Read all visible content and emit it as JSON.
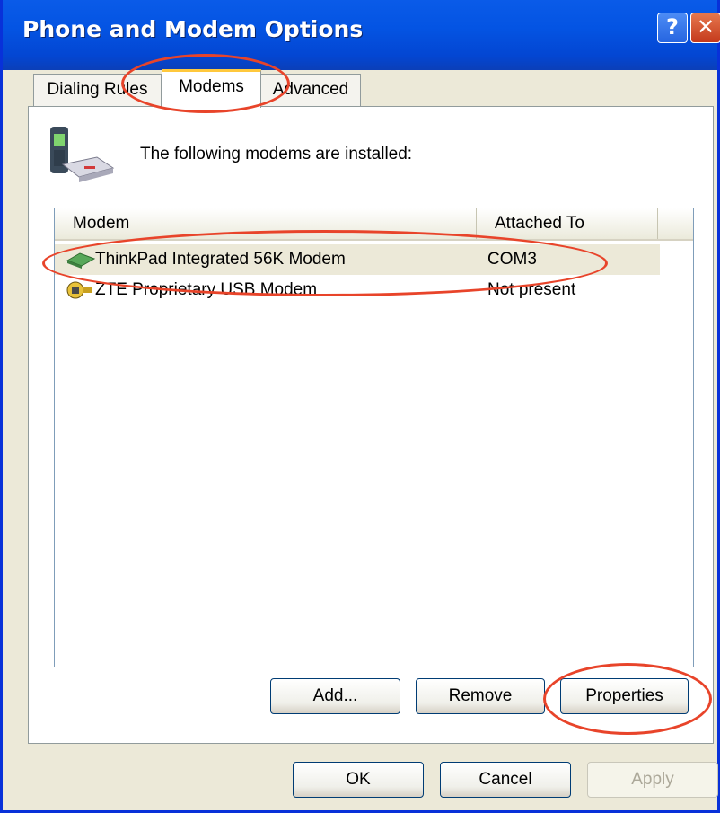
{
  "window": {
    "title": "Phone and Modem Options",
    "help_glyph": "?",
    "close_glyph": "✕"
  },
  "tabs": [
    {
      "label": "Dialing Rules",
      "selected": false
    },
    {
      "label": "Modems",
      "selected": true
    },
    {
      "label": "Advanced",
      "selected": false
    }
  ],
  "modems_tab": {
    "intro_text": "The following modems are installed:",
    "icon": "phone-modem-icon",
    "columns": [
      "Modem",
      "Attached To"
    ],
    "rows": [
      {
        "name": "ThinkPad Integrated 56K Modem",
        "attached_to": "COM3",
        "icon": "modem-card-icon",
        "selected": true
      },
      {
        "name": "ZTE Proprietary USB Modem",
        "attached_to": "Not present",
        "icon": "usb-modem-icon",
        "selected": false
      }
    ],
    "buttons": {
      "add": "Add...",
      "remove": "Remove",
      "properties": "Properties"
    }
  },
  "footer_buttons": {
    "ok": "OK",
    "cancel": "Cancel",
    "apply": "Apply",
    "apply_enabled": false
  },
  "colors": {
    "titlebar": "#0454E3",
    "highlight_annotation": "#E8442A",
    "dialog_bg": "#ECE9D8"
  }
}
